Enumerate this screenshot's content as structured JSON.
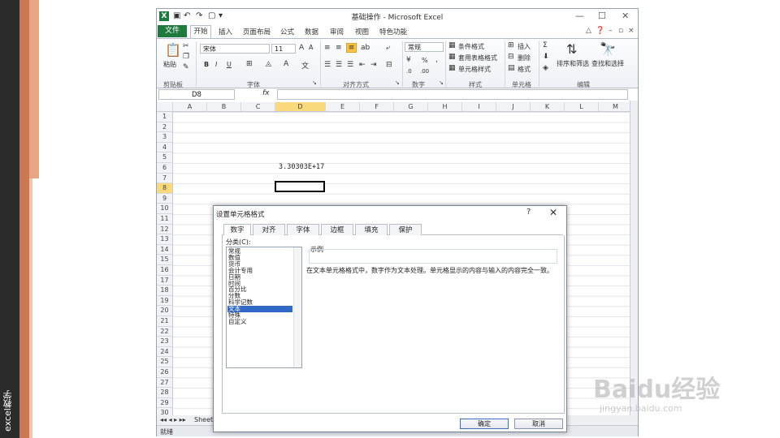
{
  "slide": {
    "side_text": "excel教学"
  },
  "window": {
    "title": "基础操作 - Microsoft Excel",
    "app_icon": "X",
    "min_icon": "—",
    "max_icon": "☐",
    "close_icon": "✕"
  },
  "ribbon_tabs": [
    "文件",
    "开始",
    "插入",
    "页面布局",
    "公式",
    "数据",
    "审阅",
    "视图",
    "特色功能"
  ],
  "ribbon": {
    "paste": "粘贴",
    "font_name": "宋体",
    "font_size": "11",
    "number_format": "常规",
    "bold": "B",
    "italic": "I",
    "underline": "U",
    "conditional_format": "条件格式",
    "table_format": "套用表格格式",
    "cell_style": "单元格样式",
    "insert": "插入",
    "delete": "删除",
    "format": "格式",
    "sort_filter": "排序和筛选",
    "find_select": "查找和选择",
    "percent": "%",
    "groups": [
      "剪贴板",
      "字体",
      "对齐方式",
      "数字",
      "样式",
      "单元格",
      "编辑"
    ]
  },
  "formula_bar": {
    "name_box": "D8",
    "fx": "fx"
  },
  "grid": {
    "columns": [
      "A",
      "B",
      "C",
      "D",
      "E",
      "F",
      "G",
      "H",
      "I",
      "J",
      "K",
      "L",
      "M"
    ],
    "rows": [
      "1",
      "2",
      "3",
      "4",
      "5",
      "6",
      "7",
      "8",
      "9",
      "10",
      "11",
      "12",
      "13",
      "14",
      "15",
      "16",
      "17",
      "18",
      "19",
      "20",
      "21",
      "22",
      "23",
      "24",
      "25",
      "26",
      "27",
      "28",
      "29",
      "30"
    ],
    "selected_column": "D",
    "selected_row": "8",
    "cell_d5": "3.30303E+17"
  },
  "sheet_tab": "Sheet",
  "status": "就绪",
  "dialog": {
    "title": "设置单元格格式",
    "help": "?",
    "close": "✕",
    "tabs": [
      "数字",
      "对齐",
      "字体",
      "边框",
      "填充",
      "保护"
    ],
    "category_label": "分类(C):",
    "categories": [
      "常规",
      "数值",
      "货币",
      "会计专用",
      "日期",
      "时间",
      "百分比",
      "分数",
      "科学记数",
      "文本",
      "特殊",
      "自定义"
    ],
    "selected_category": "文本",
    "sample_label": "示例",
    "description": "在文本单元格格式中，数字作为文本处理。单元格显示的内容与输入的内容完全一致。",
    "ok": "确定",
    "cancel": "取消"
  },
  "watermark": {
    "main": "Baidu经验",
    "sub": "jingyan.baidu.com"
  }
}
